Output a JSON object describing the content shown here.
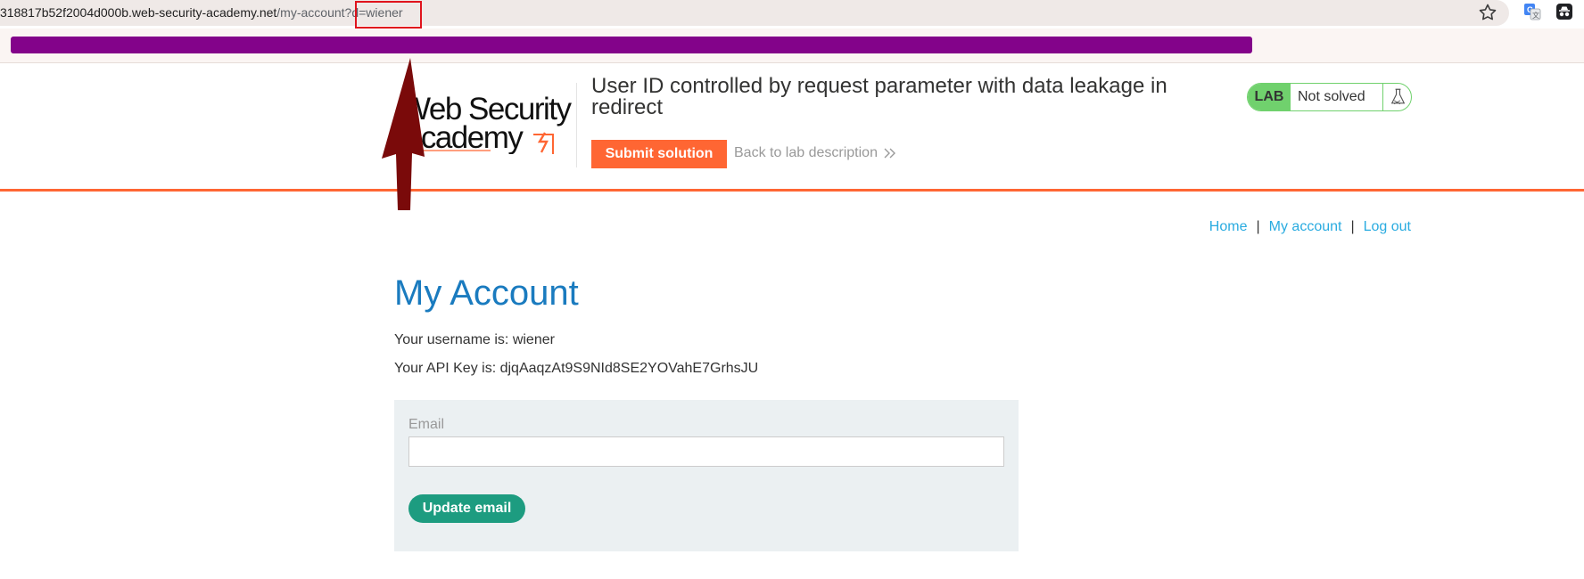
{
  "browser": {
    "url_host": "318817b52f2004d000b.web-security-academy.net",
    "url_path": "/my-account?",
    "url_param": "d=wiener",
    "icons": [
      "star-icon",
      "translate-extension-icon",
      "incognito-extension-icon"
    ]
  },
  "header": {
    "logo_line1": "Web Security",
    "logo_line2": "Academy",
    "title": "User ID controlled by request parameter with data leakage in redirect",
    "submit_label": "Submit solution",
    "back_label": "Back to lab description",
    "lab_badge": "LAB",
    "lab_status": "Not solved"
  },
  "nav": {
    "home": "Home",
    "separator": "|",
    "my_account": "My account",
    "log_out": "Log out"
  },
  "main": {
    "title": "My Account",
    "username_line": "Your username is: wiener",
    "api_key_line": "Your API Key is: djqAaqzAt9S9NId8SE2YOVahE7GrhsJU",
    "email_label": "Email",
    "email_value": "",
    "update_label": "Update email"
  },
  "colors": {
    "accent": "#ff6633",
    "title_blue": "#1a7bbf",
    "link_blue": "#29abe0",
    "button_green": "#1d9c80",
    "lab_green": "#70d16d",
    "annotation": "#7a0a0a",
    "redaction": "#83038a"
  }
}
